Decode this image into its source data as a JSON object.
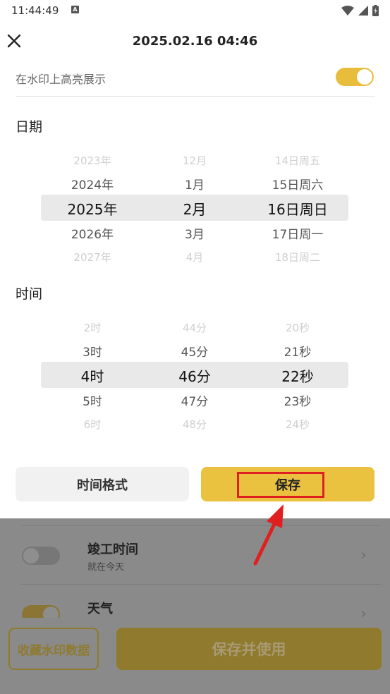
{
  "status_bar": {
    "time": "11:44:49",
    "notification_letter": "A"
  },
  "header": {
    "title": "2025.02.16 04:46"
  },
  "highlight": {
    "label": "在水印上高亮展示",
    "enabled": true
  },
  "date_section": {
    "label": "日期",
    "year": [
      "2023年",
      "2024年",
      "2025年",
      "2026年",
      "2027年"
    ],
    "month": [
      "12月",
      "1月",
      "2月",
      "3月",
      "4月"
    ],
    "day": [
      "14日周五",
      "15日周六",
      "16日周日",
      "17日周一",
      "18日周二"
    ]
  },
  "time_section": {
    "label": "时间",
    "hour": [
      "2时",
      "3时",
      "4时",
      "5时",
      "6时"
    ],
    "minute": [
      "44分",
      "45分",
      "46分",
      "47分",
      "48分"
    ],
    "second": [
      "20秒",
      "21秒",
      "22秒",
      "23秒",
      "24秒"
    ]
  },
  "actions": {
    "format_label": "时间格式",
    "save_label": "保存"
  },
  "background_list": {
    "items": [
      {
        "title": "竣工时间",
        "subtitle": "就在今天",
        "enabled": false
      },
      {
        "title": "天气",
        "subtitle": "",
        "enabled": true
      }
    ]
  },
  "bottom": {
    "collect_label": "收藏水印数据",
    "save_use_label": "保存并使用"
  },
  "colors": {
    "accent": "#ebc23f",
    "annotation": "#e02020"
  }
}
